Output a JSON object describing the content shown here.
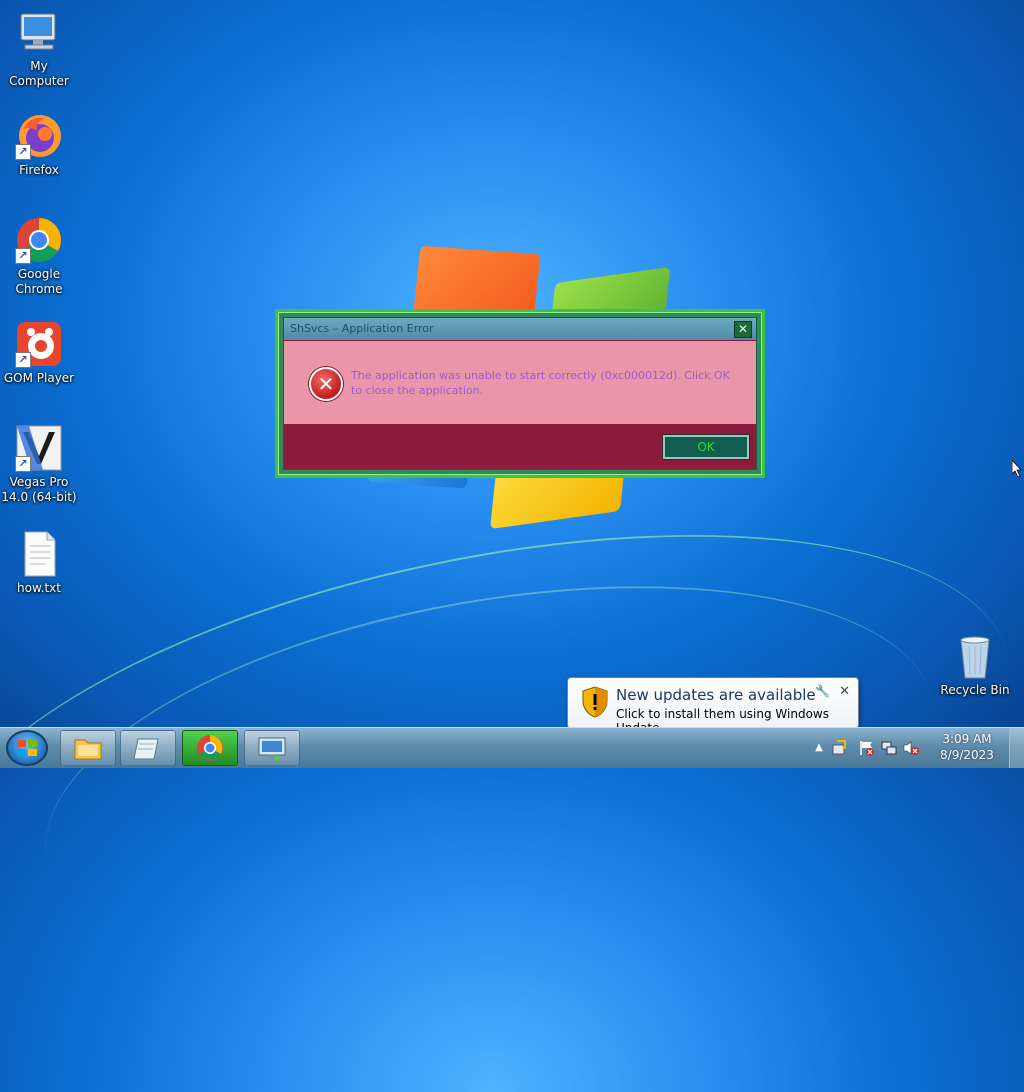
{
  "desktop": {
    "icons": [
      {
        "label": "My Computer"
      },
      {
        "label": "Firefox"
      },
      {
        "label": "Google Chrome"
      },
      {
        "label": "GOM Player"
      },
      {
        "label": "Vegas Pro 14.0 (64-bit)"
      },
      {
        "label": "how.txt"
      },
      {
        "label": "Recycle Bin"
      }
    ]
  },
  "dialog": {
    "title": "ShSvcs – Application Error",
    "message": "The application was unable to start correctly (0xc000012d). Click OK to close the application.",
    "ok_label": "OK",
    "close_label": "✕",
    "colors": {
      "frame": "#3ac63a",
      "body": "#e896a8",
      "footer": "#8b1a3c",
      "text": "#a05ad0",
      "ok_text": "#3cd63c"
    }
  },
  "notification": {
    "title": "New updates are available",
    "text": "Click to install them using Windows Update.",
    "close_label": "✕",
    "options_label": "🔧"
  },
  "taskbar": {
    "items": [
      "windows-explorer",
      "notepad",
      "google-chrome",
      "remote-desktop"
    ],
    "active": "google-chrome",
    "clock": {
      "time": "3:09 AM",
      "date": "8/9/2023"
    },
    "tray_expand_label": "▲"
  }
}
